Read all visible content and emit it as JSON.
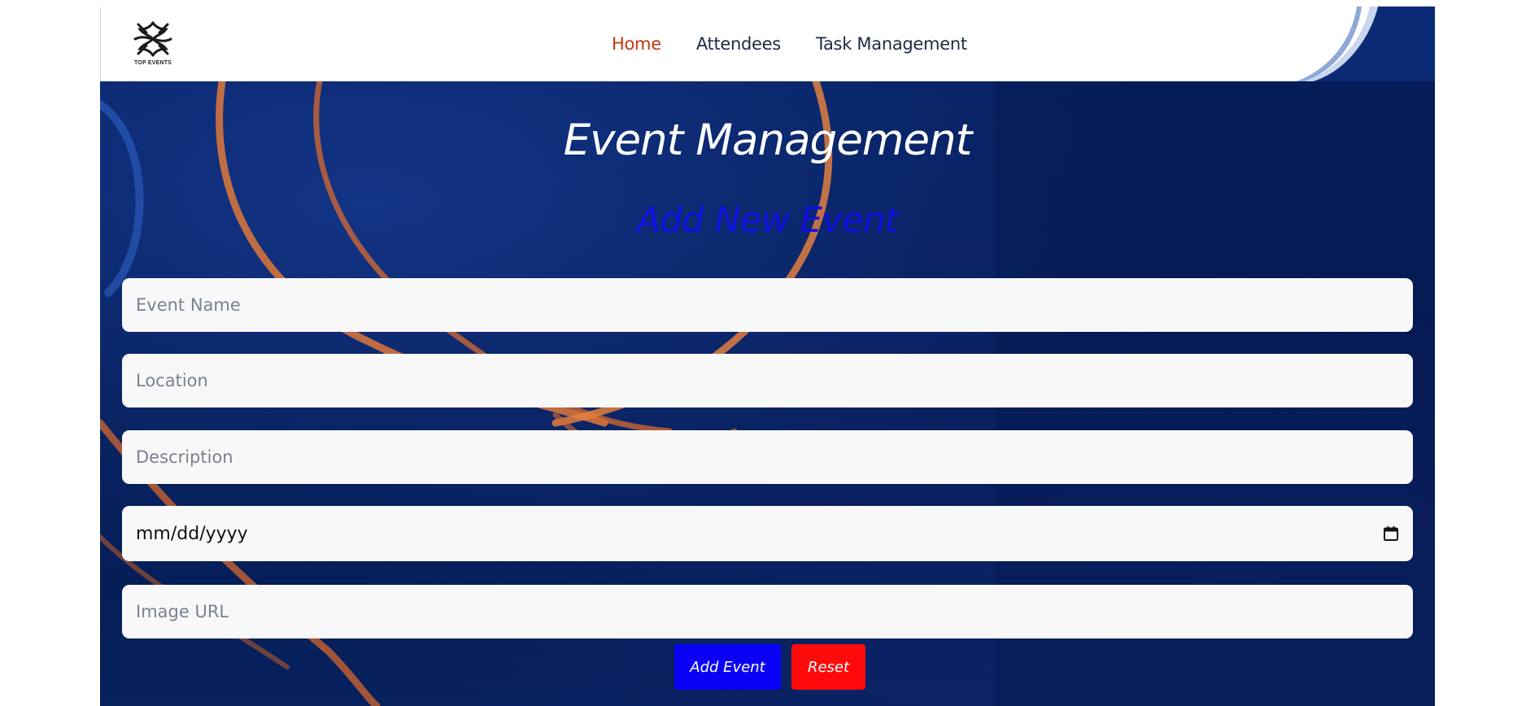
{
  "brand": {
    "logo_icon": "star-knot-logo",
    "name": "TOP EVENTS"
  },
  "nav": {
    "items": [
      {
        "label": "Home",
        "active": true
      },
      {
        "label": "Attendees",
        "active": false
      },
      {
        "label": "Task Management",
        "active": false
      }
    ],
    "active_color": "#c2370f",
    "text_color": "#1e2a44"
  },
  "main": {
    "title": "Event Management",
    "subtitle": "Add New Event",
    "subtitle_color": "#1010e0"
  },
  "form": {
    "event_name_placeholder": "Event Name",
    "location_placeholder": "Location",
    "description_placeholder": "Description",
    "date_placeholder": "mm/dd/yyyy",
    "date_icon": "calendar-icon",
    "image_url_placeholder": "Image URL",
    "add_label": "Add Event",
    "reset_label": "Reset",
    "add_color": "#0a00f5",
    "reset_color": "#ff0a0a"
  }
}
